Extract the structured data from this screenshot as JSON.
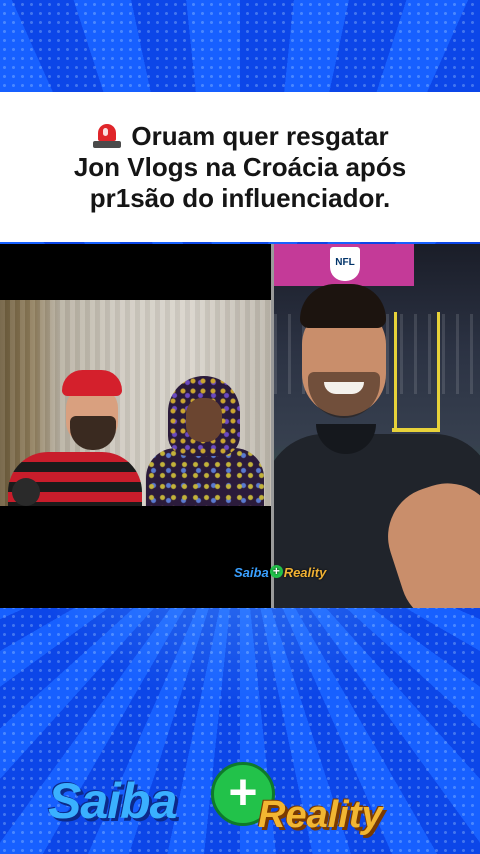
{
  "headline": {
    "icon": "police-siren-icon",
    "line1": "Oruam quer resgatar",
    "line2": "Jon Vlogs na Croácia após",
    "line3": "pr1são do influenciador."
  },
  "video": {
    "right_banner_badge": "NFL",
    "watermark_left": "Saiba",
    "watermark_plus": "+",
    "watermark_right": "Reality"
  },
  "brand": {
    "saiba": "Saiba",
    "plus": "+",
    "reality": "Reality"
  },
  "colors": {
    "background": "#0a3bd6",
    "headline_bg": "#ffffff",
    "brand_blue": "#3ab0ff",
    "brand_green": "#22c24a",
    "brand_orange": "#f2b632"
  }
}
